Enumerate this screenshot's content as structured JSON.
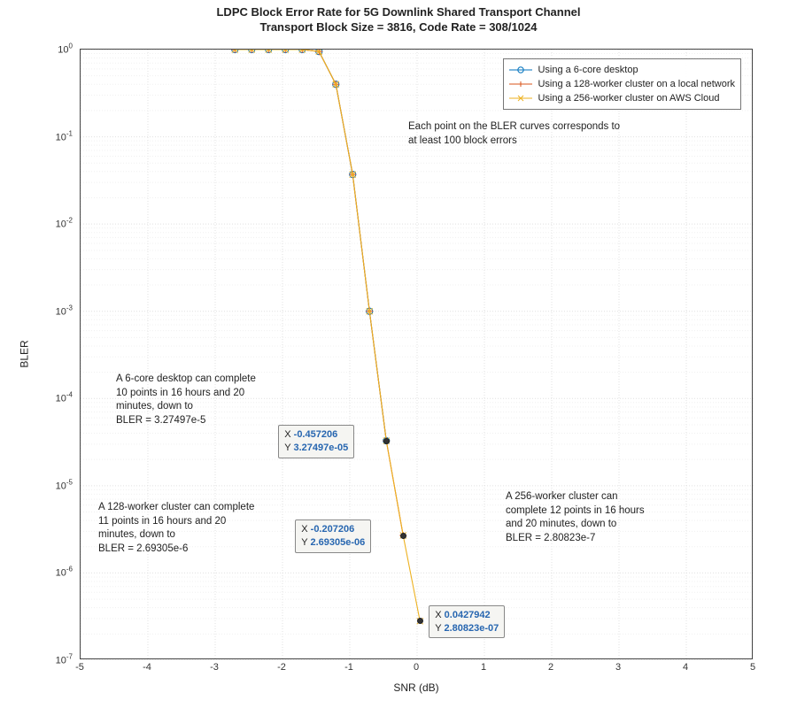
{
  "chart_data": {
    "type": "line",
    "title": "LDPC Block Error Rate for 5G Downlink Shared Transport Channel",
    "subtitle": "Transport Block Size = 3816, Code Rate = 308/1024",
    "xlabel": "SNR (dB)",
    "ylabel": "BLER",
    "xlim": [
      -5,
      5
    ],
    "ylim": [
      1e-07,
      1
    ],
    "yscale": "log",
    "grid": true,
    "legend_position": "northeast",
    "x": [
      -2.707206,
      -2.457206,
      -2.207206,
      -1.957206,
      -1.707206,
      -1.457206,
      -1.207206,
      -0.957206,
      -0.707206,
      -0.457206,
      -0.207206,
      0.0427942
    ],
    "series": [
      {
        "name": "Using a 6-core desktop",
        "color": "#0072bd",
        "marker": "o",
        "values": [
          1.0,
          1.0,
          1.0,
          1.0,
          1.0,
          0.95,
          0.4,
          0.037,
          0.001,
          3.27497e-05,
          null,
          null
        ]
      },
      {
        "name": "Using a 128-worker cluster on a local network",
        "color": "#d95319",
        "marker": "+",
        "values": [
          1.0,
          1.0,
          1.0,
          1.0,
          1.0,
          0.95,
          0.4,
          0.037,
          0.001,
          3.27497e-05,
          2.69305e-06,
          null
        ]
      },
      {
        "name": "Using a 256-worker cluster on AWS Cloud",
        "color": "#edb120",
        "marker": "x",
        "values": [
          1.0,
          1.0,
          1.0,
          1.0,
          1.0,
          0.95,
          0.4,
          0.037,
          0.001,
          3.27497e-05,
          2.69305e-06,
          2.80823e-07
        ]
      }
    ],
    "annotations": [
      {
        "text": "Each point on the BLER curves corresponds to\nat least 100 block errors",
        "x": 0.5,
        "y": 0.3
      },
      {
        "text": "A 6-core desktop can complete\n10 points in 16 hours and 20\nminutes, down to\nBLER = 3.27497e-5",
        "x": -4.1,
        "y": 0.0001
      },
      {
        "text": "A 128-worker cluster can complete\n11 points in 16 hours and 20\nminutes, down to\nBLER = 2.69305e-6",
        "x": -4.4,
        "y": 2e-06
      },
      {
        "text": "A 256-worker cluster can\ncomplete 12 points in 16 hours\nand 20 minutes, down to\nBLER = 2.80823e-7",
        "x": 1.1,
        "y": 2e-06
      }
    ],
    "datatips": [
      {
        "x": -0.457206,
        "y": 3.27497e-05,
        "xlabel": "-0.457206",
        "ylabel": "3.27497e-05"
      },
      {
        "x": -0.207206,
        "y": 2.69305e-06,
        "xlabel": "-0.207206",
        "ylabel": "2.69305e-06"
      },
      {
        "x": 0.0427942,
        "y": 2.80823e-07,
        "xlabel": "0.0427942",
        "ylabel": "2.80823e-07"
      }
    ],
    "xticks": [
      -5,
      -4,
      -3,
      -2,
      -1,
      0,
      1,
      2,
      3,
      4,
      5
    ],
    "yticks_exp": [
      0,
      -1,
      -2,
      -3,
      -4,
      -5,
      -6,
      -7
    ]
  },
  "labels": {
    "tip_x": "X",
    "tip_y": "Y"
  }
}
